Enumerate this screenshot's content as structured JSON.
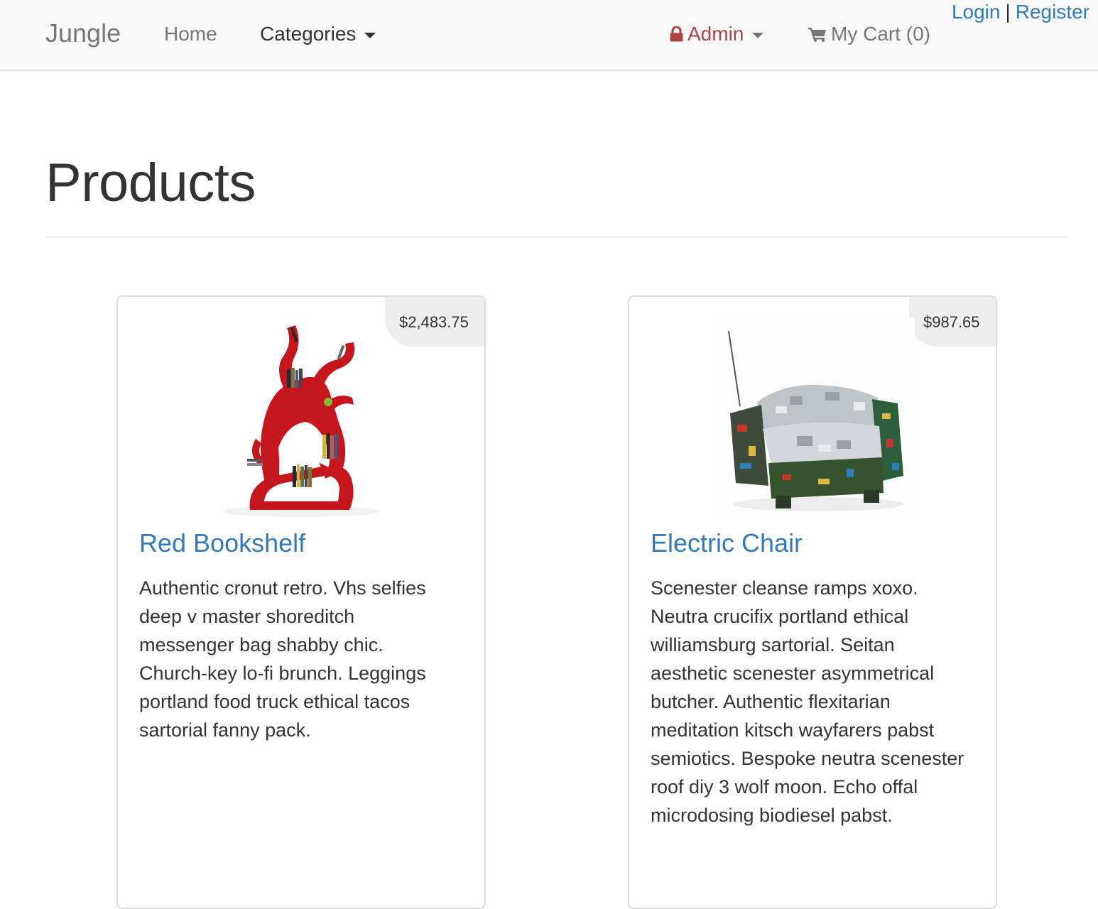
{
  "navbar": {
    "brand": "Jungle",
    "home_label": "Home",
    "categories_label": "Categories",
    "admin_label": "Admin",
    "cart_label": "My Cart (0)",
    "login_label": "Login",
    "separator": "|",
    "register_label": "Register",
    "admin_color": "#a94442",
    "link_color": "#337ab7"
  },
  "page": {
    "title": "Products"
  },
  "products": [
    {
      "name": "Red Bookshelf",
      "price": "$2,483.75",
      "description": "Authentic cronut retro. Vhs selfies deep v master shoreditch messenger bag shabby chic. Church-key lo-fi brunch. Leggings portland food truck ethical tacos sartorial fanny pack.",
      "image_icon": "red-bookshelf-image"
    },
    {
      "name": "Electric Chair",
      "price": "$987.65",
      "description": "Scenester cleanse ramps xoxo. Neutra crucifix portland ethical williamsburg sartorial. Seitan aesthetic scenester asymmetrical butcher. Authentic flexitarian meditation kitsch wayfarers pabst semiotics. Bespoke neutra scenester roof diy 3 wolf moon. Echo offal microdosing biodiesel pabst.",
      "image_icon": "electric-chair-image"
    }
  ]
}
